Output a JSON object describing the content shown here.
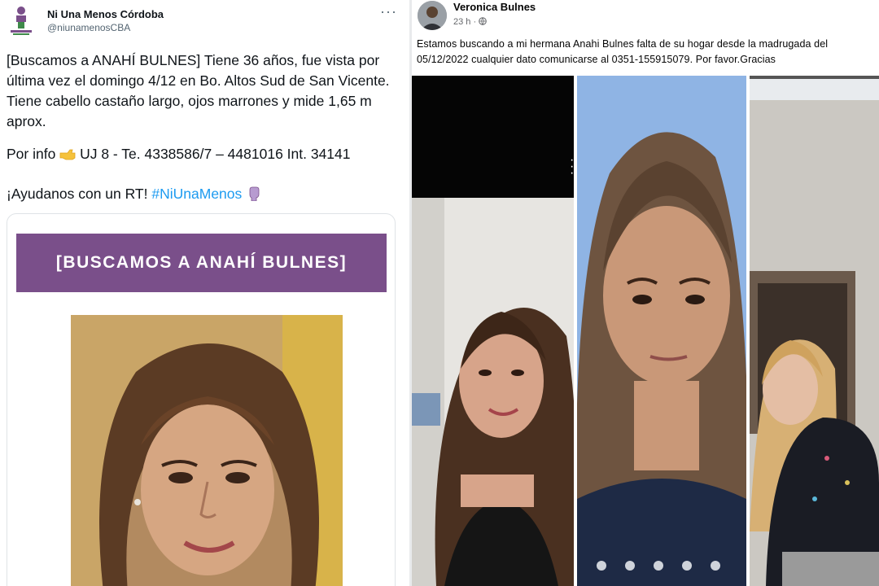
{
  "tweet": {
    "display_name": "Ni Una Menos Córdoba",
    "handle": "@niunamenosCBA",
    "more_icon": "more-horizontal-icon",
    "body": "[Buscamos a ANAHÍ BULNES] Tiene 36 años, fue vista por última vez el domingo 4/12 en Bo. Altos Sud de San Vicente. Tiene cabello castaño largo, ojos marrones y mide 1,65 m aprox.",
    "info_prefix": "Por info",
    "info_suffix": "UJ 8 - Te. 4338586/7 – 4481016 Int. 34141",
    "cta_prefix": "¡Ayudanos con un RT!",
    "hashtag": "#NiUnaMenos",
    "card_banner": "[BUSCAMOS A ANAHÍ BULNES]"
  },
  "facebook": {
    "display_name": "Veronica Bulnes",
    "time": "23 h ·",
    "post_text": "Estamos buscando a mi hermana Anahi Bulnes falta de su hogar desde la madrugada del 05/12/2022 cualquier dato comunicarse al 0351-155915079. Por favor.Gracias"
  },
  "colors": {
    "banner": "#7a4f8a",
    "hashtag": "#1d9bf0",
    "divider": "#e9eaec"
  }
}
